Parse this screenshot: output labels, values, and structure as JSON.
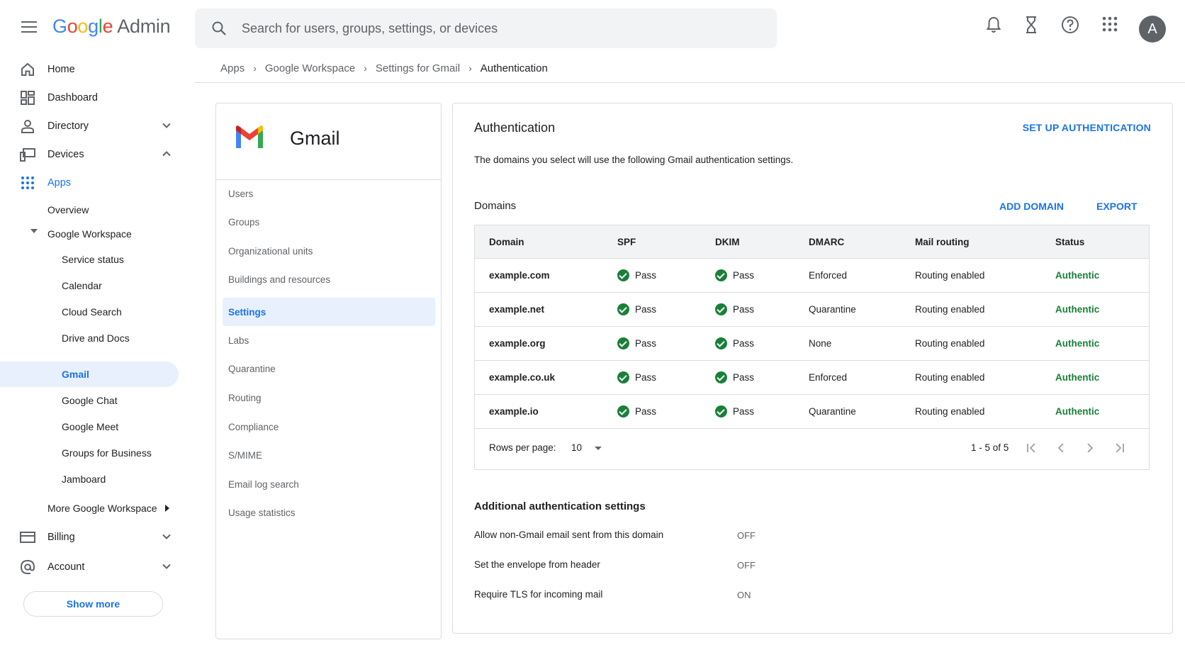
{
  "app": {
    "logo_google": "Google",
    "logo_admin": "Admin",
    "search_placeholder": "Search for users, groups, settings, or devices",
    "avatar_initial": "A"
  },
  "breadcrumb": {
    "items": [
      "Apps",
      "Google Workspace",
      "Settings for Gmail",
      "Authentication"
    ]
  },
  "sidebar": {
    "home": "Home",
    "dashboard": "Dashboard",
    "directory": "Directory",
    "devices": "Devices",
    "apps": "Apps",
    "overview": "Overview",
    "google_workspace": "Google Workspace",
    "workspace_items": [
      "Service status",
      "Calendar",
      "Cloud Search",
      "Drive and Docs",
      "Gmail",
      "Google Chat",
      "Google Meet",
      "Groups for Business",
      "Jamboard"
    ],
    "more_workspace": "More Google Workspace",
    "billing": "Billing",
    "account": "Account",
    "show_more": "Show more"
  },
  "gmail_panel": {
    "title": "Gmail",
    "menu": [
      "Users",
      "Groups",
      "Organizational units",
      "Buildings and resources",
      "Settings",
      "Labs",
      "Quarantine",
      "Routing",
      "Compliance",
      "S/MIME",
      "Email log search",
      "Usage statistics"
    ],
    "active": "Settings"
  },
  "auth": {
    "title": "Authentication",
    "setup_label": "SET UP AUTHENTICATION",
    "description": "The domains you select will use the following Gmail authentication settings.",
    "domains_title": "Domains",
    "add_domain": "ADD DOMAIN",
    "export": "EXPORT",
    "columns": [
      "Domain",
      "SPF",
      "DKIM",
      "DMARC",
      "Mail routing",
      "Status"
    ],
    "rows": [
      {
        "domain": "example.com",
        "spf": "Pass",
        "dkim": "Pass",
        "dmarc": "Enforced",
        "routing": "Routing enabled",
        "status": "Authentic"
      },
      {
        "domain": "example.net",
        "spf": "Pass",
        "dkim": "Pass",
        "dmarc": "Quarantine",
        "routing": "Routing enabled",
        "status": "Authentic"
      },
      {
        "domain": "example.org",
        "spf": "Pass",
        "dkim": "Pass",
        "dmarc": "None",
        "routing": "Routing enabled",
        "status": "Authentic"
      },
      {
        "domain": "example.co.uk",
        "spf": "Pass",
        "dkim": "Pass",
        "dmarc": "Enforced",
        "routing": "Routing enabled",
        "status": "Authentic"
      },
      {
        "domain": "example.io",
        "spf": "Pass",
        "dkim": "Pass",
        "dmarc": "Quarantine",
        "routing": "Routing enabled",
        "status": "Authentic"
      }
    ],
    "rows_per_page_label": "Rows per page:",
    "rows_per_page_value": "10",
    "range": "1 - 5 of 5",
    "additional_title": "Additional authentication settings",
    "settings": [
      {
        "label": "Allow non-Gmail email sent from this domain",
        "value": "OFF"
      },
      {
        "label": "Set the envelope from header",
        "value": "OFF"
      },
      {
        "label": "Require TLS for incoming mail",
        "value": "ON"
      }
    ]
  },
  "colors": {
    "accent": "#1a73e8",
    "pass_green": "#188038",
    "active_bg": "#e8f0fe"
  }
}
